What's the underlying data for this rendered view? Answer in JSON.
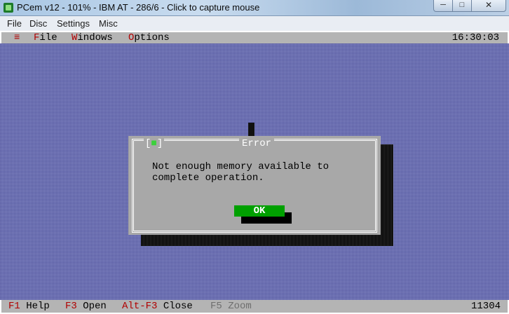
{
  "window": {
    "title": "PCem v12 - 101% - IBM AT - 286/6 - Click to capture mouse",
    "controls": {
      "minimize": "─",
      "maximize": "□",
      "close": "✕"
    }
  },
  "host_menu": [
    "File",
    "Disc",
    "Settings",
    "Misc"
  ],
  "dos": {
    "system_menu": "≡",
    "menu": [
      {
        "hotkey": "F",
        "rest": "ile"
      },
      {
        "hotkey": "W",
        "rest": "indows"
      },
      {
        "hotkey": "O",
        "rest": "ptions"
      }
    ],
    "clock": "16:30:03",
    "dialog": {
      "title": "Error",
      "close_left": "[",
      "close_mark": "■",
      "close_right": "]",
      "message_lines": [
        "Not enough memory available to",
        "complete operation."
      ],
      "ok_label": "OK"
    },
    "statusbar": {
      "items": [
        {
          "key": "F1",
          "label": "Help"
        },
        {
          "key": "F3",
          "label": "Open"
        },
        {
          "key": "Alt-F3",
          "label": "Close"
        },
        {
          "key": "F5",
          "label": "Zoom"
        }
      ],
      "memory": "11304"
    }
  }
}
